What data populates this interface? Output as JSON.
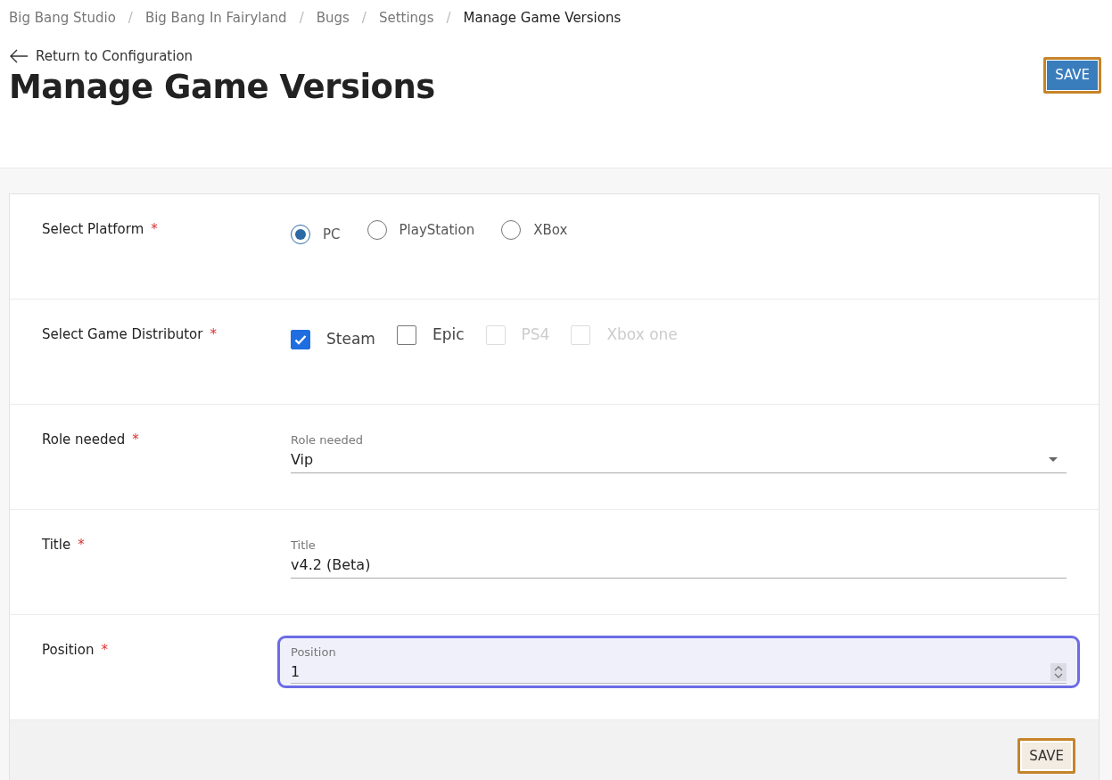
{
  "breadcrumb": [
    {
      "label": "Big Bang Studio",
      "current": false
    },
    {
      "label": "Big Bang In Fairyland",
      "current": false
    },
    {
      "label": "Bugs",
      "current": false
    },
    {
      "label": "Settings",
      "current": false
    },
    {
      "label": "Manage Game Versions",
      "current": true
    }
  ],
  "breadcrumb_separator": "/",
  "back_link": "Return to Configuration",
  "title": "Manage Game Versions",
  "header_save": {
    "label": "SAVE",
    "focused": true
  },
  "fields": [
    {
      "kind": "radio",
      "label": "Select Platform",
      "required_mark": "*",
      "options": [
        {
          "label": "PC",
          "selected": true
        },
        {
          "label": "PlayStation",
          "selected": false
        },
        {
          "label": "XBox",
          "selected": false
        }
      ]
    },
    {
      "kind": "checkbox",
      "label": "Select Game Distributor",
      "required_mark": "*",
      "options": [
        {
          "label": "Steam",
          "checked": true,
          "disabled": false
        },
        {
          "label": "Epic",
          "checked": false,
          "disabled": false
        },
        {
          "label": "PS4",
          "checked": false,
          "disabled": true
        },
        {
          "label": "Xbox one",
          "checked": false,
          "disabled": true
        }
      ]
    },
    {
      "kind": "select",
      "label": "Role needed",
      "required_mark": "*",
      "field_label": "Role needed",
      "value": "Vip",
      "focused": false
    },
    {
      "kind": "text",
      "label": "Title",
      "required_mark": "*",
      "field_label": "Title",
      "value": "v4.2 (Beta)",
      "focused": false
    },
    {
      "kind": "number",
      "label": "Position",
      "required_mark": "*",
      "field_label": "Position",
      "value": "1",
      "focused": true
    }
  ],
  "footer_save": {
    "label": "SAVE",
    "focused": true
  }
}
